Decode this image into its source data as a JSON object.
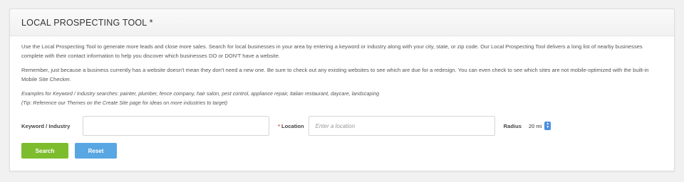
{
  "panel": {
    "title": "LOCAL PROSPECTING TOOL *"
  },
  "description": {
    "paragraph1": "Use the Local Prospecting Tool to generate more leads and close more sales. Search for local businesses in your area by entering a keyword or industry along with your city, state, or zip code. Our Local Prospecting Tool delivers a long list of nearby businesses complete with their contact information to help you discover which businesses DO or DON'T have a website.",
    "paragraph2": "Remember, just because a business currently has a website doesn't mean they don't need a new one. Be sure to check out any existing websites to see which are due for a redesign. You can even check to see which sites are not mobile-optimized with the built-in Mobile Site Checker.",
    "examples": "Examples for Keyword / Industry searches: painter, plumber, fence company, hair salon, pest control, appliance repair, italian restaurant, daycare, landscaping",
    "tip": "(Tip: Reference our Themes on the Create Site page for ideas on more industries to target)"
  },
  "form": {
    "keyword_label": "Keyword / Industry",
    "keyword_value": "",
    "location_required_marker": "*",
    "location_label": "Location",
    "location_placeholder": "Enter a location",
    "radius_label": "Radius",
    "radius_value": "20 mi"
  },
  "buttons": {
    "search_label": "Search",
    "reset_label": "Reset"
  },
  "colors": {
    "search_button": "#7dbd2d",
    "reset_button": "#58a6e2",
    "required_marker": "#d9534f"
  },
  "icons": {
    "radius_stepper": "chevron-up-down-icon"
  }
}
